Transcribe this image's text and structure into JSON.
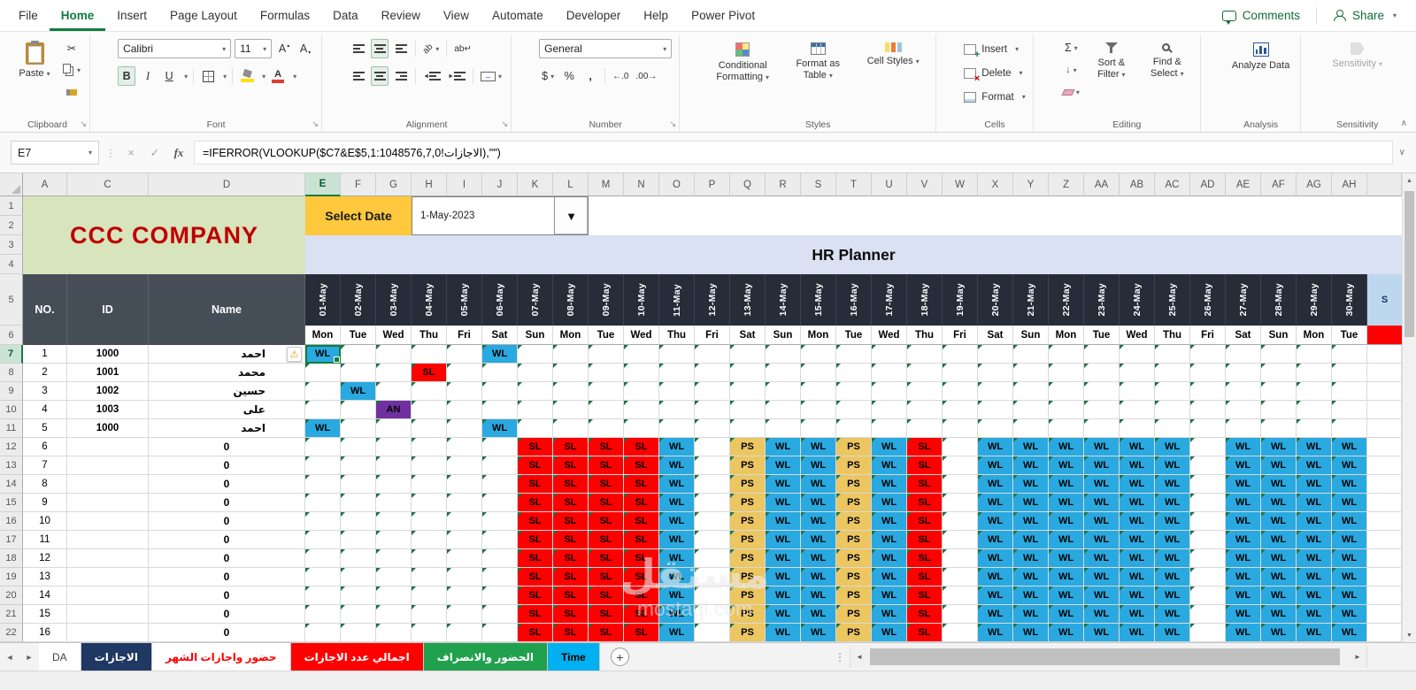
{
  "ribbon": {
    "tabs": [
      "File",
      "Home",
      "Insert",
      "Page Layout",
      "Formulas",
      "Data",
      "Review",
      "View",
      "Automate",
      "Developer",
      "Help",
      "Power Pivot"
    ],
    "active_tab": "Home",
    "comments": "Comments",
    "share": "Share",
    "groups": {
      "clipboard": {
        "label": "Clipboard",
        "paste": "Paste"
      },
      "font": {
        "label": "Font",
        "name": "Calibri",
        "size": "11",
        "bold": "B",
        "italic": "I",
        "underline": "U"
      },
      "alignment": {
        "label": "Alignment",
        "orient_text": "ab",
        "wrap_text": "ab"
      },
      "number": {
        "label": "Number",
        "format": "General"
      },
      "styles": {
        "label": "Styles",
        "conditional": "Conditional Formatting",
        "format_table": "Format as Table",
        "cell_styles": "Cell Styles"
      },
      "cells": {
        "label": "Cells",
        "insert": "Insert",
        "delete": "Delete",
        "format": "Format"
      },
      "editing": {
        "label": "Editing",
        "sort_filter": "Sort & Filter",
        "find_select": "Find & Select"
      },
      "analysis": {
        "label": "Analysis",
        "analyze": "Analyze Data"
      },
      "sensitivity": {
        "label": "Sensitivity",
        "button": "Sensitivity"
      }
    }
  },
  "formula_bar": {
    "name_box": "E7",
    "formula": "=IFERROR(VLOOKUP($C7&E$5,الاجازات!1:1048576,7,0),\"\")"
  },
  "sheet": {
    "company": "CCC COMPANY",
    "select_date_label": "Select Date",
    "select_date_value": "1-May-2023",
    "title": "HR Planner",
    "header_no": "NO.",
    "header_id": "ID",
    "header_name": "Name",
    "extra_col_row5": "S",
    "col_letters": [
      "A",
      "C",
      "D",
      "E",
      "F",
      "G",
      "H",
      "I",
      "J",
      "K",
      "L",
      "M",
      "N",
      "O",
      "P",
      "Q",
      "R",
      "S",
      "T",
      "U",
      "V",
      "W",
      "X",
      "Y",
      "Z",
      "AA",
      "AB",
      "AC",
      "AD",
      "AE",
      "AF",
      "AG",
      "AH"
    ],
    "row_numbers": [
      1,
      2,
      3,
      4,
      5,
      6,
      7,
      8,
      9,
      10,
      11,
      12,
      13,
      14,
      15,
      16,
      17,
      18,
      19,
      20,
      21,
      22
    ],
    "dates": [
      "01-May",
      "02-May",
      "03-May",
      "04-May",
      "05-May",
      "06-May",
      "07-May",
      "08-May",
      "09-May",
      "10-May",
      "11-May",
      "12-May",
      "13-May",
      "14-May",
      "15-May",
      "16-May",
      "17-May",
      "18-May",
      "19-May",
      "20-May",
      "21-May",
      "22-May",
      "23-May",
      "24-May",
      "25-May",
      "26-May",
      "27-May",
      "28-May",
      "29-May",
      "30-May"
    ],
    "days": [
      "Mon",
      "Tue",
      "Wed",
      "Thu",
      "Fri",
      "Sat",
      "Sun",
      "Mon",
      "Tue",
      "Wed",
      "Thu",
      "Fri",
      "Sat",
      "Sun",
      "Mon",
      "Tue",
      "Wed",
      "Thu",
      "Fri",
      "Sat",
      "Sun",
      "Mon",
      "Tue",
      "Wed",
      "Thu",
      "Fri",
      "Sat",
      "Sun",
      "Mon",
      "Tue"
    ],
    "selection": {
      "col_letter": "E",
      "row_number": "7"
    },
    "patterns": {
      "std": {
        "6": "SL",
        "7": "SL",
        "8": "SL",
        "9": "SL",
        "10": "WL",
        "12": "PS",
        "13": "WL",
        "14": "WL",
        "15": "PS",
        "16": "WL",
        "17": "SL",
        "19": "WL",
        "20": "WL",
        "21": "WL",
        "22": "WL",
        "23": "WL",
        "24": "WL",
        "26": "WL",
        "27": "WL",
        "28": "WL",
        "29": "WL"
      }
    },
    "rows": [
      {
        "no": "1",
        "id": "1000",
        "name": "احمد",
        "warn": true,
        "cells": {
          "0": "WL",
          "5": "WL"
        }
      },
      {
        "no": "2",
        "id": "1001",
        "name": "محمد",
        "cells": {
          "3": "SL"
        }
      },
      {
        "no": "3",
        "id": "1002",
        "name": "حسين",
        "cells": {
          "1": "WL"
        }
      },
      {
        "no": "4",
        "id": "1003",
        "name": "على",
        "cells": {
          "2": "AN"
        }
      },
      {
        "no": "5",
        "id": "1000",
        "name": "احمد",
        "cells": {
          "0": "WL",
          "5": "WL"
        }
      },
      {
        "no": "6",
        "id": "",
        "name": "0",
        "pattern": "std"
      },
      {
        "no": "7",
        "id": "",
        "name": "0",
        "pattern": "std"
      },
      {
        "no": "8",
        "id": "",
        "name": "0",
        "pattern": "std"
      },
      {
        "no": "9",
        "id": "",
        "name": "0",
        "pattern": "std"
      },
      {
        "no": "10",
        "id": "",
        "name": "0",
        "pattern": "std"
      },
      {
        "no": "11",
        "id": "",
        "name": "0",
        "pattern": "std"
      },
      {
        "no": "12",
        "id": "",
        "name": "0",
        "pattern": "std"
      },
      {
        "no": "13",
        "id": "",
        "name": "0",
        "pattern": "std"
      },
      {
        "no": "14",
        "id": "",
        "name": "0",
        "pattern": "std"
      },
      {
        "no": "15",
        "id": "",
        "name": "0",
        "pattern": "std"
      },
      {
        "no": "16",
        "id": "",
        "name": "0",
        "pattern": "std"
      }
    ]
  },
  "tabs_bar": {
    "new_sheet": "+",
    "sheet_tabs": [
      {
        "label": "DA",
        "bg": "#FFFFFF",
        "color": "#444444",
        "active": false
      },
      {
        "label": "الاجازات",
        "bg": "#1F3864",
        "color": "#FFFFFF",
        "active": false
      },
      {
        "label": "حضور واجازات الشهر",
        "bg": "#FFFFFF",
        "color": "#FF0000",
        "active": true
      },
      {
        "label": "اجمالي عدد الاجازات",
        "bg": "#FF0000",
        "color": "#FFFFFF",
        "active": false
      },
      {
        "label": "الحضور والانصراف",
        "bg": "#21A04D",
        "color": "#FFFFFF",
        "active": false
      },
      {
        "label": "Time",
        "bg": "#00B0F0",
        "color": "#000000",
        "active": false
      }
    ]
  },
  "watermark": {
    "line1": "مستقل",
    "line2": "mostaql.com"
  },
  "colors": {
    "accent_green": "#107C41",
    "company_bg": "#D7E4BC",
    "company_text": "#C00000",
    "select_date_bg": "#FFC83D",
    "planner_bg": "#D9E1F2",
    "table_header_bg": "#454D57",
    "date_header_bg": "#262C38",
    "extra_col_bg": "#BDD7EE",
    "status": {
      "WL": "#29A9E0",
      "SL": "#FE0000",
      "AN": "#7030A0",
      "PS": "#EBC661"
    }
  },
  "icons": {
    "dd": "▾",
    "launcher": "↘",
    "cut": "✂",
    "sigma": "Σ",
    "dollar": "$",
    "percent": "%",
    "comma": ",",
    "inc_decimal": "←.0",
    "dec_decimal": ".00→",
    "check": "✓",
    "cross": "×",
    "fx": "fx",
    "vdots": "⋮",
    "left_arrow": "◄",
    "right_arrow": "►",
    "up_arrow": "▲",
    "down_arrow": "▼",
    "collapse": "∧",
    "expand": "∨",
    "warning": "⚠",
    "fill_down": "↓",
    "wrap_return": "↵",
    "merge_arrows": "↔"
  }
}
